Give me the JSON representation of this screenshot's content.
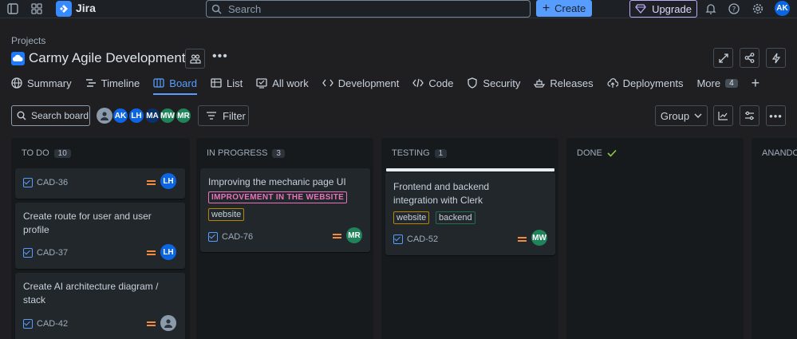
{
  "topbar": {
    "app_name": "Jira",
    "search_placeholder": "Search",
    "create_label": "Create",
    "upgrade_label": "Upgrade",
    "user_initials": "AK"
  },
  "header": {
    "breadcrumb": "Projects",
    "project_title": "Carmy Agile Development"
  },
  "tabs": [
    {
      "label": "Summary",
      "icon": "globe-icon"
    },
    {
      "label": "Timeline",
      "icon": "timeline-icon"
    },
    {
      "label": "Board",
      "icon": "board-icon",
      "active": true
    },
    {
      "label": "List",
      "icon": "list-icon"
    },
    {
      "label": "All work",
      "icon": "all-work-icon"
    },
    {
      "label": "Development",
      "icon": "development-icon"
    },
    {
      "label": "Code",
      "icon": "code-icon"
    },
    {
      "label": "Security",
      "icon": "shield-icon"
    },
    {
      "label": "Releases",
      "icon": "ship-icon"
    },
    {
      "label": "Deployments",
      "icon": "cloud-upload-icon"
    },
    {
      "label": "More",
      "count": "4"
    }
  ],
  "toolbar": {
    "search_board_placeholder": "Search board",
    "avatars": [
      "AK",
      "LH",
      "MA",
      "MW",
      "MR"
    ],
    "filter_label": "Filter",
    "group_label": "Group"
  },
  "columns": [
    {
      "name": "TO DO",
      "count": "10",
      "cards": [
        {
          "title": "",
          "key": "CAD-36",
          "assignee": "LH"
        },
        {
          "title": "Create route for user and user profile",
          "key": "CAD-37",
          "assignee": "LH"
        },
        {
          "title": "Create AI architecture diagram / stack",
          "key": "CAD-42",
          "assignee": ""
        }
      ]
    },
    {
      "name": "IN PROGRESS",
      "count": "3",
      "cards": [
        {
          "title": "Improving the mechanic page UI",
          "epic": "IMPROVEMENT IN THE WEBSITE",
          "labels": [
            "website"
          ],
          "key": "CAD-76",
          "assignee": "MR"
        }
      ]
    },
    {
      "name": "TESTING",
      "count": "1",
      "cards": [
        {
          "title": "Frontend and backend integration with Clerk",
          "labels": [
            "website",
            "backend"
          ],
          "key": "CAD-52",
          "assignee": "MW"
        }
      ]
    },
    {
      "name": "DONE",
      "count": ""
    },
    {
      "name": "ANANDO",
      "count": ""
    }
  ],
  "colors": {
    "accent": "#579dff",
    "avatar_lh": "#0c66e4",
    "avatar_mr": "#1f845a",
    "avatar_mw": "#1f845a",
    "avatar_ak": "#0c66e4",
    "avatar_ma": "#0052cc",
    "priority_medium": "#f38a3f",
    "epic": "#e774bb"
  }
}
